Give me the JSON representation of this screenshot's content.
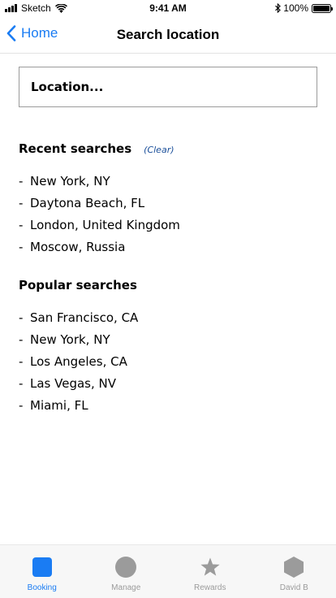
{
  "status_bar": {
    "carrier": "Sketch",
    "time": "9:41 AM",
    "battery": "100%"
  },
  "nav": {
    "back_label": "Home",
    "title": "Search location"
  },
  "search": {
    "placeholder": "Location..."
  },
  "recent": {
    "title": "Recent searches",
    "clear_label": "(Clear)",
    "items": [
      "New York, NY",
      "Daytona Beach, FL",
      "London, United Kingdom",
      "Moscow, Russia"
    ]
  },
  "popular": {
    "title": "Popular searches",
    "items": [
      "San Francisco, CA",
      "New York, NY",
      "Los Angeles, CA",
      "Las Vegas, NV",
      "Miami, FL"
    ]
  },
  "list_bullet": "-",
  "tabs": [
    {
      "label": "Booking",
      "icon": "booking-square-icon",
      "active": true
    },
    {
      "label": "Manage",
      "icon": "manage-circle-icon",
      "active": false
    },
    {
      "label": "Rewards",
      "icon": "rewards-star-icon",
      "active": false
    },
    {
      "label": "David B",
      "icon": "profile-hexagon-icon",
      "active": false
    }
  ],
  "colors": {
    "accent": "#1a7cf3",
    "inactive": "#9b9b9b",
    "clear_link": "#1b4f9a"
  }
}
